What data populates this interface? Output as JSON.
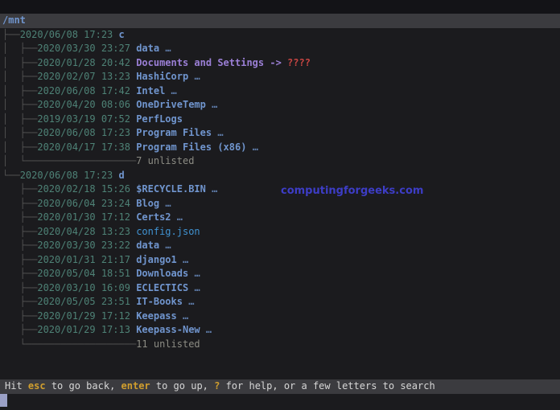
{
  "app": "broot-file-tree-terminal",
  "root_path": "/mnt",
  "watermark": {
    "text": "computingforgeeks.com"
  },
  "colors": {
    "background": "#1b1b1e",
    "selection_bg": "#3b3b3f",
    "tree_line": "#515151",
    "date": "#4e8276",
    "directory": "#7095ce",
    "file": "#4093d2",
    "symlink": "#9b7fd6",
    "broken_link": "#c64542",
    "unlisted": "#8c8c84",
    "status_key": "#d09e2e",
    "status_text": "#d6d6d6",
    "watermark": "#3d3dc6",
    "cursor": "#9aa0c6"
  },
  "tree": {
    "rows": [
      {
        "kind": "root",
        "name": "/mnt",
        "selected": true
      },
      {
        "kind": "drive",
        "prefix": "├──",
        "date": "2020/06/08 17:23",
        "name": "c",
        "suffix": ""
      },
      {
        "kind": "dir",
        "prefix": "│  ├──",
        "date": "2020/03/30 23:27",
        "name": "data",
        "suffix": " …"
      },
      {
        "kind": "symlink",
        "prefix": "│  ├──",
        "date": "2020/01/28 20:42",
        "name": "Documents and Settings",
        "arrow": " -> ",
        "target": "????"
      },
      {
        "kind": "dir",
        "prefix": "│  ├──",
        "date": "2020/02/07 13:23",
        "name": "HashiCorp",
        "suffix": " …"
      },
      {
        "kind": "dir",
        "prefix": "│  ├──",
        "date": "2020/06/08 17:42",
        "name": "Intel",
        "suffix": " …"
      },
      {
        "kind": "dir",
        "prefix": "│  ├──",
        "date": "2020/04/20 08:06",
        "name": "OneDriveTemp",
        "suffix": " …"
      },
      {
        "kind": "dir",
        "prefix": "│  ├──",
        "date": "2019/03/19 07:52",
        "name": "PerfLogs",
        "suffix": ""
      },
      {
        "kind": "dir",
        "prefix": "│  ├──",
        "date": "2020/06/08 17:23",
        "name": "Program Files",
        "suffix": " …"
      },
      {
        "kind": "dir",
        "prefix": "│  ├──",
        "date": "2020/04/17 17:38",
        "name": "Program Files (x86)",
        "suffix": " …"
      },
      {
        "kind": "unlisted",
        "prefix": "│  └───────────────────",
        "text": "7 unlisted"
      },
      {
        "kind": "drive",
        "prefix": "└──",
        "date": "2020/06/08 17:23",
        "name": "d",
        "suffix": ""
      },
      {
        "kind": "dir",
        "prefix": "   ├──",
        "date": "2020/02/18 15:26",
        "name": "$RECYCLE.BIN",
        "suffix": " …"
      },
      {
        "kind": "dir",
        "prefix": "   ├──",
        "date": "2020/06/04 23:24",
        "name": "Blog",
        "suffix": " …"
      },
      {
        "kind": "dir",
        "prefix": "   ├──",
        "date": "2020/01/30 17:12",
        "name": "Certs2",
        "suffix": " …"
      },
      {
        "kind": "file",
        "prefix": "   ├──",
        "date": "2020/04/28 13:23",
        "name": "config.json",
        "suffix": ""
      },
      {
        "kind": "dir",
        "prefix": "   ├──",
        "date": "2020/03/30 23:22",
        "name": "data",
        "suffix": " …"
      },
      {
        "kind": "dir",
        "prefix": "   ├──",
        "date": "2020/01/31 21:17",
        "name": "django1",
        "suffix": " …"
      },
      {
        "kind": "dir",
        "prefix": "   ├──",
        "date": "2020/05/04 18:51",
        "name": "Downloads",
        "suffix": " …"
      },
      {
        "kind": "dir",
        "prefix": "   ├──",
        "date": "2020/03/10 16:09",
        "name": "ECLECTICS",
        "suffix": " …"
      },
      {
        "kind": "dir",
        "prefix": "   ├──",
        "date": "2020/05/05 23:51",
        "name": "IT-Books",
        "suffix": " …"
      },
      {
        "kind": "dir",
        "prefix": "   ├──",
        "date": "2020/01/29 17:12",
        "name": "Keepass",
        "suffix": " …"
      },
      {
        "kind": "dir",
        "prefix": "   ├──",
        "date": "2020/01/29 17:13",
        "name": "Keepass-New",
        "suffix": " …"
      },
      {
        "kind": "unlisted",
        "prefix": "   └───────────────────",
        "text": "11 unlisted"
      }
    ]
  },
  "status": {
    "segments": [
      {
        "text": "Hit "
      },
      {
        "text": "esc",
        "key": true
      },
      {
        "text": " to go back, "
      },
      {
        "text": "enter",
        "key": true
      },
      {
        "text": " to go up, "
      },
      {
        "text": "?",
        "key": true
      },
      {
        "text": " for help, or a few letters to search"
      }
    ]
  }
}
